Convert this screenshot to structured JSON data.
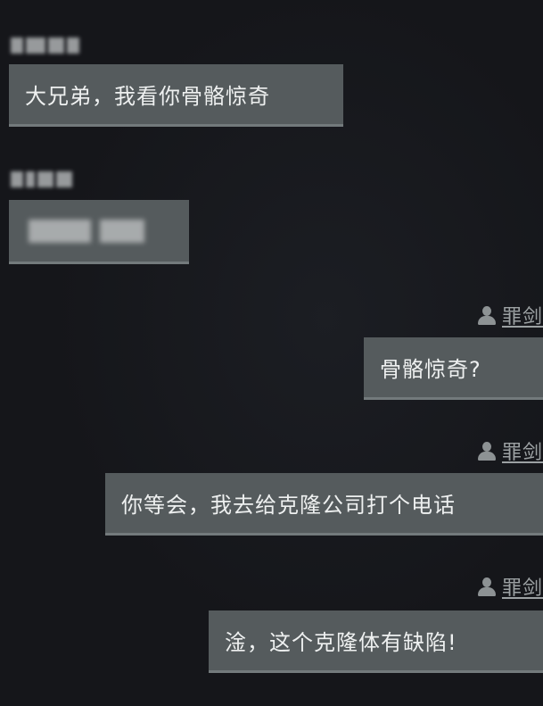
{
  "messages": [
    {
      "side": "left",
      "sender": "",
      "text": "大兄弟，我看你骨骼惊奇"
    },
    {
      "side": "left",
      "sender": "",
      "text": ""
    },
    {
      "side": "right",
      "sender": "罪剑",
      "text": "骨骼惊奇?"
    },
    {
      "side": "right",
      "sender": "罪剑",
      "text": "你等会，我去给克隆公司打个电话"
    },
    {
      "side": "right",
      "sender": "罪剑",
      "text": "淦，这个克隆体有缺陷!"
    }
  ],
  "icons": {
    "sender_avatar": "person-icon"
  },
  "colors": {
    "background": "#15161a",
    "bubble": "#555b5d",
    "bubble_text": "#eef0f0",
    "sender_name": "#9ca1a3"
  }
}
